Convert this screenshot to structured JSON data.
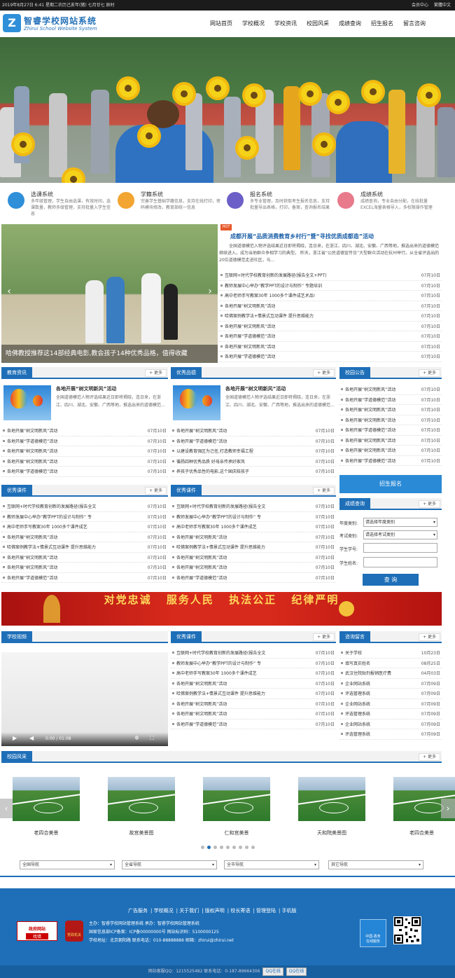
{
  "topbar": {
    "date": "2019年8月27日 6:41 星期二农历己亥年(猪) 七月廿七 辰时",
    "links": [
      "会员中心",
      "繁體中文"
    ]
  },
  "header": {
    "logo_char": "Z",
    "logo_cn": "智睿学校网站系统",
    "logo_en": "Zhirui School Website System",
    "nav": [
      "网站首页",
      "学校概况",
      "学校资讯",
      "校园风采",
      "成绩查询",
      "招生报名",
      "留言咨询"
    ]
  },
  "features": [
    {
      "title": "选课系统",
      "desc": "多年级管理，学生自由选课，有效时间，选课数量，教师多级管理，支持批量入学生信息",
      "color": "#2f8fd8"
    },
    {
      "title": "学籍系统",
      "desc": "完善学生基础学籍信息，支持在线打印，密码模块修改，教育部统一信息",
      "color": "#f2a531"
    },
    {
      "title": "报名系统",
      "desc": "多专业管理，及时获取考生报名信息，支持批量导出表格，打印，备案，查询报名结果",
      "color": "#6c5fc7"
    },
    {
      "title": "成绩系统",
      "desc": "成绩查询，专业自由分配，在线批量EXCEL海量表格导入，多权限操作管理",
      "color": "#e87a8b"
    }
  ],
  "slider": {
    "caption": "哈佛教授推荐这14部经典电影,教会孩子14种优秀品格，值得收藏",
    "dots": 5
  },
  "headline": {
    "hot": "HOT",
    "title": "成都开展“品质消费教育乡村行”暨“寻找优质成都造”活动",
    "summary": "全国道德模范入物评选结果近日即将揭晓，连日来，在浙江、四川、湖北、安徽、广西等地，推选出来的道德模范继续进入，成为当地群众争相学习的典型。 昨天，浙江省“公民道德宣传日”大型群众活动在杭州举行。从全省评选出的20位道德模范走进社区，与..."
  },
  "news_list": [
    {
      "t": "互联网+时代学校教育创新的发展路径(报告全文+PPT)",
      "d": "07月10日"
    },
    {
      "t": "教师发展中心举办“教学PPT的设计与制作” 专题培训",
      "d": "07月10日"
    },
    {
      "t": "高中老师手写教案30年 1000多个课件成艺术品!",
      "d": "07月10日"
    },
    {
      "t": "各地开展“树文明新风”活动",
      "d": "07月10日"
    },
    {
      "t": "哈佛案例教学法+情景式互动课件 提升思维能力",
      "d": "07月10日"
    },
    {
      "t": "各地开展“树文明新风”活动",
      "d": "07月10日"
    },
    {
      "t": "各地开展“学道德模范”活动",
      "d": "07月10日"
    },
    {
      "t": "各地开展“树文明新风”活动",
      "d": "07月10日"
    },
    {
      "t": "各地开展“学道德模范”活动",
      "d": "07月10日"
    }
  ],
  "more": "+ 更多",
  "edu_news": {
    "title": "教育资讯",
    "img_title": "各地开展“树文明新风”活动",
    "img_desc": "全国道德模范人物评选结果近日即将揭晓，连日来，在浙江、四川、湖北、安徽、广西等地，推选出来的道德模范...",
    "items": [
      {
        "t": "各地开展“树文明新风”活动",
        "d": "07月10日"
      },
      {
        "t": "各地开展“学道德模范”活动",
        "d": "07月10日"
      },
      {
        "t": "各地开展“树文明新风”活动",
        "d": "07月10日"
      },
      {
        "t": "各地开展“树文明新风”活动",
        "d": "07月10日"
      },
      {
        "t": "各地开展“学道德模范”活动",
        "d": "07月10日"
      }
    ]
  },
  "quality": {
    "title": "优秀品德",
    "img_title": "各地开展“树文明新风”活动",
    "img_desc": "全国道德模范人物评选结果近日即将揭晓，连日来，在浙江、四川、湖北、安徽、广西等地，推选出来的道德模范...",
    "items": [
      {
        "t": "各地开展“树文明新风”活动",
        "d": "07月10日"
      },
      {
        "t": "各地开展“学道德模范”活动",
        "d": "07月10日"
      },
      {
        "t": "以建设教育强区为己任,打造教师幸福工程",
        "d": "07月10日"
      },
      {
        "t": "循扬四种优秀品质 好母亲传承好家风",
        "d": "07月10日"
      },
      {
        "t": "养孩子优秀品性的电影,这个国庆陪孩子",
        "d": "07月10日"
      }
    ]
  },
  "notice": {
    "title": "校园公告",
    "items": [
      {
        "t": "各地开展“树文明新风”活动",
        "d": "07月10日"
      },
      {
        "t": "各地开展“学道德模范”活动",
        "d": "07月10日"
      },
      {
        "t": "各地开展“树文明新风”活动",
        "d": "07月10日"
      },
      {
        "t": "各地开展“树文明新风”活动",
        "d": "07月10日"
      },
      {
        "t": "各地开展“学道德模范”活动",
        "d": "07月10日"
      },
      {
        "t": "各地开展“树文明新风”活动",
        "d": "07月10日"
      },
      {
        "t": "各地开展“树文明新风”活动",
        "d": "07月10日"
      },
      {
        "t": "各地开展“学道德模范”活动",
        "d": "07月10日"
      }
    ]
  },
  "enroll": "招生报名",
  "courses_a": {
    "title": "优秀课件",
    "items": [
      {
        "t": "互联网+时代学校教育创新的发展路径(报告全文",
        "d": "07月10日"
      },
      {
        "t": "教师发展中心举办“教学PPT的设计与制作” 专",
        "d": "07月10日"
      },
      {
        "t": "高中老师手写教案30年 1000多个课件成艺",
        "d": "07月10日"
      },
      {
        "t": "各地开展“树文明新风”活动",
        "d": "07月10日"
      },
      {
        "t": "哈佛案例教学法+情景式互动课件 提升思维能力",
        "d": "07月10日"
      },
      {
        "t": "各地开展“树文明新风”活动",
        "d": "07月10日"
      },
      {
        "t": "各地开展“树文明新风”活动",
        "d": "07月10日"
      },
      {
        "t": "各地开展“学道德模范”活动",
        "d": "07月10日"
      }
    ]
  },
  "courses_b": {
    "title": "优秀课件",
    "items": [
      {
        "t": "互联网+时代学校教育创新的发展路径(报告全文",
        "d": "07月10日"
      },
      {
        "t": "教师发展中心举办“教学PPT的设计与制作” 专",
        "d": "07月10日"
      },
      {
        "t": "高中老师手写教案30年 1000多个课件成艺",
        "d": "07月10日"
      },
      {
        "t": "各地开展“树文明新风”活动",
        "d": "07月10日"
      },
      {
        "t": "哈佛案例教学法+情景式互动课件 提升思维能力",
        "d": "07月10日"
      },
      {
        "t": "各地开展“树文明新风”活动",
        "d": "07月10日"
      },
      {
        "t": "各地开展“树文明新风”活动",
        "d": "07月10日"
      },
      {
        "t": "各地开展“学道德模范”活动",
        "d": "07月10日"
      }
    ]
  },
  "score": {
    "title": "成绩查询",
    "year_label": "年度类别:",
    "year_value": "请选择年度类别",
    "exam_label": "考试类别:",
    "exam_value": "请选择考试类别",
    "id_label": "学生学号:",
    "name_label": "学生姓名:",
    "button": "查 询"
  },
  "party_banner": "对党忠诚 服务人民 执法公正 纪律严明",
  "video": {
    "title": "学校视频",
    "time": "0:00 / 01:08"
  },
  "courses_c": {
    "title": "优秀课件",
    "items": [
      {
        "t": "互联网+时代学校教育创新的发展路径(报告全文",
        "d": "07月10日"
      },
      {
        "t": "教师发展中心举办“教学PPT的设计与制作” 专",
        "d": "07月10日"
      },
      {
        "t": "高中老师手写教案30年 1000多个课件成艺",
        "d": "07月10日"
      },
      {
        "t": "各地开展“树文明新风”活动",
        "d": "07月10日"
      },
      {
        "t": "哈佛案例教学法+情景式互动课件 提升思维能力",
        "d": "07月10日"
      },
      {
        "t": "各地开展“树文明新风”活动",
        "d": "07月10日"
      },
      {
        "t": "各地开展“树文明新风”活动",
        "d": "07月10日"
      },
      {
        "t": "各地开展“学道德模范”活动",
        "d": "07月10日"
      }
    ]
  },
  "consult": {
    "title": "咨询留言",
    "items": [
      {
        "t": "关于学校",
        "d": "10月23日"
      },
      {
        "t": "填写真实姓名",
        "d": "08月25日"
      },
      {
        "t": "武汉住院贴剂报销医疗费",
        "d": "04月03日"
      },
      {
        "t": "企业网站系统",
        "d": "07月09日"
      },
      {
        "t": "评选管理系统",
        "d": "07月09日"
      },
      {
        "t": "企业网站系统",
        "d": "07月09日"
      },
      {
        "t": "评选管理系统",
        "d": "07月09日"
      },
      {
        "t": "企业网站系统",
        "d": "07月09日"
      },
      {
        "t": "评选管理系统",
        "d": "07月09日"
      }
    ]
  },
  "gallery": {
    "title": "校园风采",
    "items": [
      "老四合美景",
      "故宫美景图",
      "仁和宫美景",
      "天和院美景图",
      "老四合美景"
    ]
  },
  "links": [
    "全国导航",
    "全省导航",
    "全市导航",
    "其它导航"
  ],
  "footer": {
    "nav": [
      "广告服务",
      "学校概况",
      "关于我们",
      "版权声明",
      "校长寄语",
      "管理登陆",
      "手机版"
    ],
    "host": "主办：智睿学校网站管理系统 承办：智睿学校网站管理系统",
    "icp": "国家信息部ICP备案：ICP备00000000号 网站标识码：5100000125",
    "addr": "学校地址：北京朝阳路 联系电话：010-88888886 邮箱：zhirui@zhirui.net",
    "gov1": "政府网站",
    "gov1b": "找错",
    "gov2": "党政机关",
    "gov3": "中国·政务",
    "gov3b": "在线服务",
    "copy": "网站客服QQ：1215525482 联系电话：0-187-89664306",
    "qq1": "QQ在线",
    "qq2": "QQ在线"
  }
}
